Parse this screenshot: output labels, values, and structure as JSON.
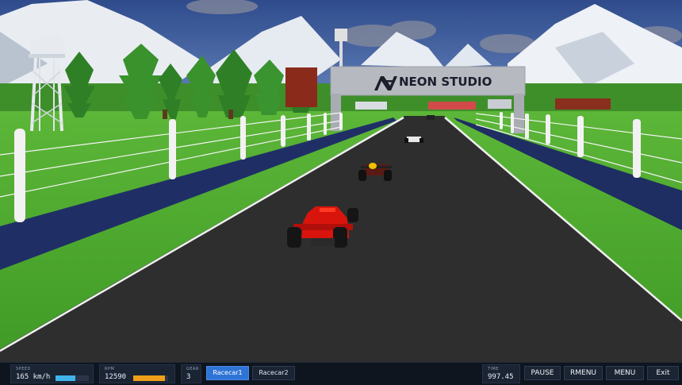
{
  "banner": {
    "logo_text": "NEON STUDIO"
  },
  "hud": {
    "speed": {
      "caption": "SPEED",
      "value": "165 km/h",
      "level": 0.6
    },
    "rpm": {
      "caption": "RPM",
      "value": "12590",
      "level": 0.9
    },
    "gear": {
      "caption": "GEAR",
      "value": "3"
    },
    "cars": [
      {
        "label": "Racecar1",
        "active": true
      },
      {
        "label": "Racecar2",
        "active": false
      }
    ],
    "time": {
      "caption": "TIME",
      "value": "997.45"
    },
    "buttons": {
      "pause": "PAUSE",
      "rmenu": "RMENU",
      "menu": "MENU",
      "exit": "Exit"
    }
  },
  "colors": {
    "sky": "#3e5ca0",
    "grass": "#4faa2e",
    "track": "#2e2e2e",
    "barrier": "#1f2f66",
    "player_car": "#d8140c",
    "accent": "#2e74d6",
    "speed_fill": "#3fb4ec",
    "rpm_fill": "#f0a018"
  }
}
